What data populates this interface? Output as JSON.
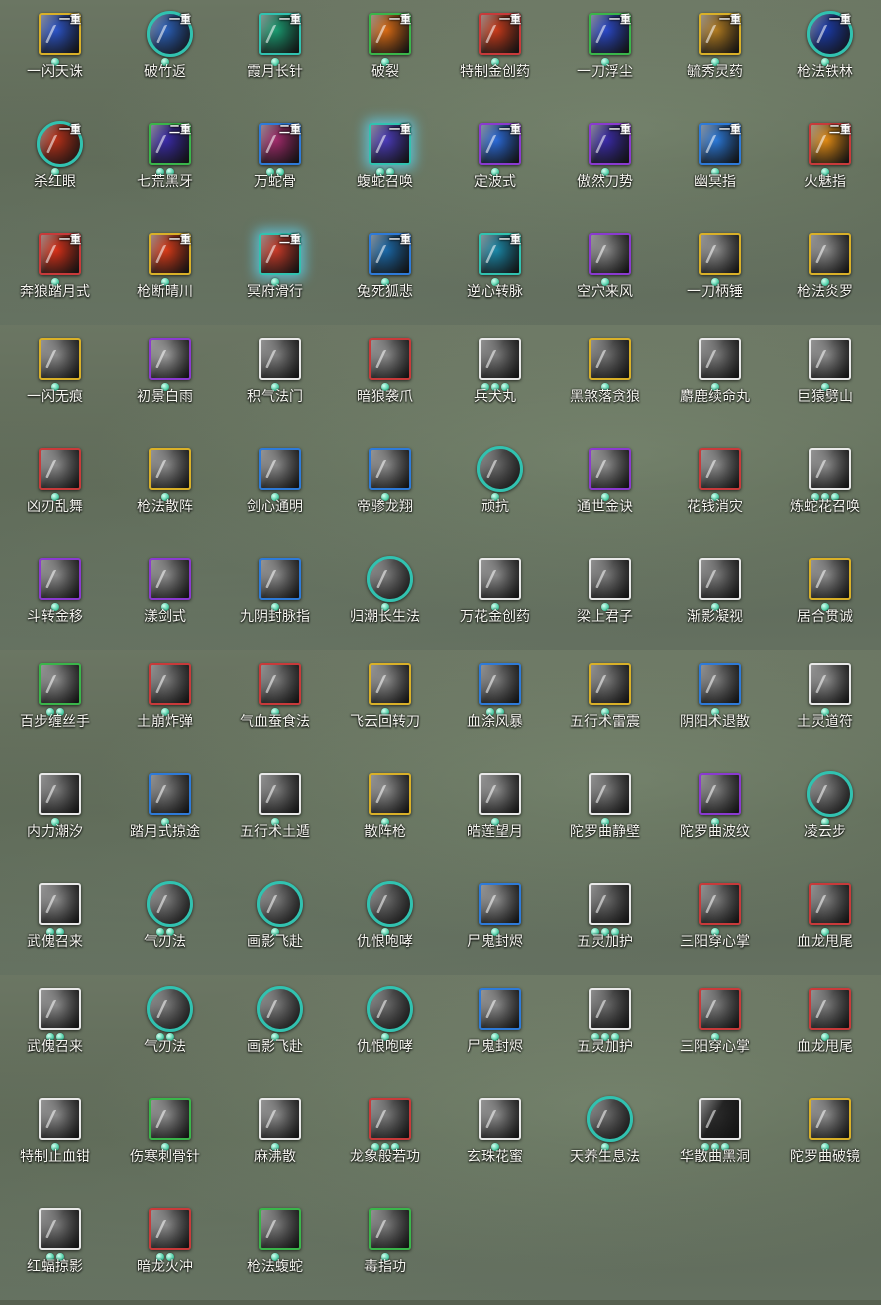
{
  "colors": {
    "white": "#e8e8e8",
    "yellow": "#d9b028",
    "green": "#3ab54a",
    "blue": "#2e7ad8",
    "purple": "#8a3ad0",
    "red": "#c83a3a",
    "teal": "#31c2b0"
  },
  "skills": [
    {
      "name": "一闪天诛",
      "rank": "一重",
      "dots": 1,
      "frame": "yellow",
      "fill": "#2c54c8",
      "shape": "square"
    },
    {
      "name": "破竹返",
      "rank": "一重",
      "dots": 1,
      "frame": "teal",
      "fill": "#2a5fb8",
      "shape": "round"
    },
    {
      "name": "霞月长针",
      "rank": "一重",
      "dots": 1,
      "frame": "teal",
      "fill": "#1a9a70",
      "shape": "square"
    },
    {
      "name": "破裂",
      "rank": "一重",
      "dots": 1,
      "frame": "green",
      "fill": "#d86a14",
      "shape": "square"
    },
    {
      "name": "特制金创药",
      "rank": "一重",
      "dots": 1,
      "frame": "red",
      "fill": "#c83a1a",
      "shape": "square"
    },
    {
      "name": "一刀浮尘",
      "rank": "一重",
      "dots": 1,
      "frame": "green",
      "fill": "#2a48c8",
      "shape": "square"
    },
    {
      "name": "毓秀灵药",
      "rank": "一重",
      "dots": 1,
      "frame": "yellow",
      "fill": "#b07a20",
      "shape": "square"
    },
    {
      "name": "枪法铁林",
      "rank": "一重",
      "dots": 1,
      "frame": "teal",
      "fill": "#1a3aa8",
      "shape": "round"
    },
    {
      "name": "杀红眼",
      "rank": "一重",
      "dots": 1,
      "frame": "teal",
      "fill": "#b83018",
      "shape": "round"
    },
    {
      "name": "七荒黑牙",
      "rank": "二重",
      "dots": 2,
      "frame": "green",
      "fill": "#3a2aa8",
      "shape": "square"
    },
    {
      "name": "万蛇骨",
      "rank": "二重",
      "dots": 2,
      "frame": "blue",
      "fill": "#a02a6a",
      "shape": "square"
    },
    {
      "name": "蝮蛇召唤",
      "rank": "一重",
      "dots": 2,
      "frame": "teal",
      "fill": "#4a3ab8",
      "shape": "square",
      "glow": true
    },
    {
      "name": "定波式",
      "rank": "一重",
      "dots": 1,
      "frame": "purple",
      "fill": "#2a6ad8",
      "shape": "square"
    },
    {
      "name": "傲然刀势",
      "rank": "一重",
      "dots": 1,
      "frame": "purple",
      "fill": "#3a2aa8",
      "shape": "square"
    },
    {
      "name": "幽冥指",
      "rank": "一重",
      "dots": 1,
      "frame": "blue",
      "fill": "#2a78d8",
      "shape": "square"
    },
    {
      "name": "火魅指",
      "rank": "二重",
      "dots": 1,
      "frame": "red",
      "fill": "#e08a14",
      "shape": "square"
    },
    {
      "name": "奔狼踏月式",
      "rank": "一重",
      "dots": 1,
      "frame": "red",
      "fill": "#d83018",
      "shape": "square"
    },
    {
      "name": "枪断晴川",
      "rank": "一重",
      "dots": 1,
      "frame": "yellow",
      "fill": "#d83a18",
      "shape": "square"
    },
    {
      "name": "冥府滑行",
      "rank": "二重",
      "dots": 1,
      "frame": "teal",
      "fill": "#c83a28",
      "shape": "square",
      "glow": true
    },
    {
      "name": "兔死狐悲",
      "rank": "一重",
      "dots": 1,
      "frame": "blue",
      "fill": "#1a68a8",
      "shape": "square"
    },
    {
      "name": "逆心转脉",
      "rank": "一重",
      "dots": 1,
      "frame": "teal",
      "fill": "#1a88a8",
      "shape": "square"
    },
    {
      "name": "空穴来风",
      "rank": "",
      "dots": 1,
      "frame": "purple",
      "fill": "#888888",
      "shape": "square"
    },
    {
      "name": "一刀柄锤",
      "rank": "",
      "dots": 1,
      "frame": "yellow",
      "fill": "#8a8a8a",
      "shape": "square"
    },
    {
      "name": "枪法炎罗",
      "rank": "",
      "dots": 1,
      "frame": "yellow",
      "fill": "#8a8a8a",
      "shape": "square"
    },
    {
      "name": "一闪无痕",
      "rank": "",
      "dots": 1,
      "frame": "yellow",
      "fill": "#8a8a8a",
      "shape": "square"
    },
    {
      "name": "初景白雨",
      "rank": "",
      "dots": 1,
      "frame": "purple",
      "fill": "#9a9a9a",
      "shape": "square"
    },
    {
      "name": "积气法门",
      "rank": "",
      "dots": 1,
      "frame": "white",
      "fill": "#808080",
      "shape": "square"
    },
    {
      "name": "暗狼袭爪",
      "rank": "",
      "dots": 1,
      "frame": "red",
      "fill": "#8a8a8a",
      "shape": "square"
    },
    {
      "name": "兵犬丸",
      "rank": "",
      "dots": 3,
      "frame": "white",
      "fill": "#7a7a7a",
      "shape": "square"
    },
    {
      "name": "黑煞落贪狼",
      "rank": "",
      "dots": 1,
      "frame": "yellow",
      "fill": "#707070",
      "shape": "square"
    },
    {
      "name": "麝鹿续命丸",
      "rank": "",
      "dots": 1,
      "frame": "white",
      "fill": "#7a7a7a",
      "shape": "square"
    },
    {
      "name": "巨猿劈山",
      "rank": "",
      "dots": 1,
      "frame": "white",
      "fill": "#8a8a8a",
      "shape": "square"
    },
    {
      "name": "凶刃乱舞",
      "rank": "",
      "dots": 1,
      "frame": "red",
      "fill": "#8a8a8a",
      "shape": "square"
    },
    {
      "name": "枪法散阵",
      "rank": "",
      "dots": 1,
      "frame": "yellow",
      "fill": "#8a8a8a",
      "shape": "square"
    },
    {
      "name": "剑心通明",
      "rank": "",
      "dots": 1,
      "frame": "blue",
      "fill": "#8a8a8a",
      "shape": "square"
    },
    {
      "name": "帝骖龙翔",
      "rank": "",
      "dots": 1,
      "frame": "blue",
      "fill": "#8a8a8a",
      "shape": "square"
    },
    {
      "name": "顽抗",
      "rank": "",
      "dots": 1,
      "frame": "teal",
      "fill": "#6a6a6a",
      "shape": "round"
    },
    {
      "name": "通世金诀",
      "rank": "",
      "dots": 1,
      "frame": "purple",
      "fill": "#8a8a8a",
      "shape": "square"
    },
    {
      "name": "花钱消灾",
      "rank": "",
      "dots": 1,
      "frame": "red",
      "fill": "#8a8a8a",
      "shape": "square"
    },
    {
      "name": "炼蛇花召唤",
      "rank": "",
      "dots": 3,
      "frame": "white",
      "fill": "#8a8a8a",
      "shape": "square"
    },
    {
      "name": "斗转金移",
      "rank": "",
      "dots": 1,
      "frame": "purple",
      "fill": "#8a8a8a",
      "shape": "square"
    },
    {
      "name": "漾剑式",
      "rank": "",
      "dots": 1,
      "frame": "purple",
      "fill": "#8a8a8a",
      "shape": "square"
    },
    {
      "name": "九阴封脉指",
      "rank": "",
      "dots": 1,
      "frame": "blue",
      "fill": "#8a8a8a",
      "shape": "square"
    },
    {
      "name": "归潮长生法",
      "rank": "",
      "dots": 1,
      "frame": "teal",
      "fill": "#7a7a7a",
      "shape": "round"
    },
    {
      "name": "万花金创药",
      "rank": "",
      "dots": 1,
      "frame": "white",
      "fill": "#8a8a8a",
      "shape": "square"
    },
    {
      "name": "梁上君子",
      "rank": "",
      "dots": 1,
      "frame": "white",
      "fill": "#7a7a7a",
      "shape": "square"
    },
    {
      "name": "渐影凝视",
      "rank": "",
      "dots": 1,
      "frame": "white",
      "fill": "#7a7a7a",
      "shape": "square"
    },
    {
      "name": "居合贯诚",
      "rank": "",
      "dots": 1,
      "frame": "yellow",
      "fill": "#8a8a8a",
      "shape": "square"
    },
    {
      "name": "百步缠丝手",
      "rank": "",
      "dots": 2,
      "frame": "green",
      "fill": "#8a8a8a",
      "shape": "square"
    },
    {
      "name": "土崩炸弹",
      "rank": "",
      "dots": 1,
      "frame": "red",
      "fill": "#7a7a7a",
      "shape": "square"
    },
    {
      "name": "气血蚕食法",
      "rank": "",
      "dots": 1,
      "frame": "red",
      "fill": "#7a7a7a",
      "shape": "square"
    },
    {
      "name": "飞云回转刀",
      "rank": "",
      "dots": 1,
      "frame": "yellow",
      "fill": "#8a8a8a",
      "shape": "square"
    },
    {
      "name": "血涂风暴",
      "rank": "",
      "dots": 2,
      "frame": "blue",
      "fill": "#7a7a7a",
      "shape": "square"
    },
    {
      "name": "五行术雷震",
      "rank": "",
      "dots": 1,
      "frame": "yellow",
      "fill": "#7a7a7a",
      "shape": "square"
    },
    {
      "name": "阴阳术退散",
      "rank": "",
      "dots": 1,
      "frame": "blue",
      "fill": "#7a7a7a",
      "shape": "square"
    },
    {
      "name": "土灵道符",
      "rank": "",
      "dots": 1,
      "frame": "white",
      "fill": "#8a8a8a",
      "shape": "square"
    },
    {
      "name": "内力潮汐",
      "rank": "",
      "dots": 1,
      "frame": "white",
      "fill": "#7a7a7a",
      "shape": "square"
    },
    {
      "name": "踏月式掠途",
      "rank": "",
      "dots": 1,
      "frame": "blue",
      "fill": "#7a7a7a",
      "shape": "square"
    },
    {
      "name": "五行术土遁",
      "rank": "",
      "dots": 1,
      "frame": "white",
      "fill": "#7a7a7a",
      "shape": "square"
    },
    {
      "name": "散阵枪",
      "rank": "",
      "dots": 1,
      "frame": "yellow",
      "fill": "#8a8a8a",
      "shape": "square"
    },
    {
      "name": "皓莲望月",
      "rank": "",
      "dots": 1,
      "frame": "white",
      "fill": "#8a8a8a",
      "shape": "square"
    },
    {
      "name": "陀罗曲静壁",
      "rank": "",
      "dots": 1,
      "frame": "white",
      "fill": "#7a7a7a",
      "shape": "square"
    },
    {
      "name": "陀罗曲波纹",
      "rank": "",
      "dots": 1,
      "frame": "purple",
      "fill": "#7a7a7a",
      "shape": "square"
    },
    {
      "name": "凌云步",
      "rank": "",
      "dots": 1,
      "frame": "teal",
      "fill": "#7a7a7a",
      "shape": "round"
    },
    {
      "name": "武傀召来",
      "rank": "",
      "dots": 2,
      "frame": "white",
      "fill": "#8a8a8a",
      "shape": "square"
    },
    {
      "name": "气刃法",
      "rank": "",
      "dots": 2,
      "frame": "teal",
      "fill": "#7a7a7a",
      "shape": "round"
    },
    {
      "name": "画影飞赴",
      "rank": "",
      "dots": 1,
      "frame": "teal",
      "fill": "#7a7a7a",
      "shape": "round"
    },
    {
      "name": "仇恨咆哮",
      "rank": "",
      "dots": 1,
      "frame": "teal",
      "fill": "#6a6a6a",
      "shape": "round"
    },
    {
      "name": "尸鬼封烬",
      "rank": "",
      "dots": 1,
      "frame": "blue",
      "fill": "#8a8a8a",
      "shape": "square"
    },
    {
      "name": "五灵加护",
      "rank": "",
      "dots": 3,
      "frame": "white",
      "fill": "#6a6a6a",
      "shape": "square"
    },
    {
      "name": "三阳穿心掌",
      "rank": "",
      "dots": 1,
      "frame": "red",
      "fill": "#7a7a7a",
      "shape": "square"
    },
    {
      "name": "血龙甩尾",
      "rank": "",
      "dots": 1,
      "frame": "red",
      "fill": "#7a7a7a",
      "shape": "square"
    },
    {
      "name": "武傀召来",
      "rank": "",
      "dots": 2,
      "frame": "white",
      "fill": "#8a8a8a",
      "shape": "square"
    },
    {
      "name": "气刃法",
      "rank": "",
      "dots": 2,
      "frame": "teal",
      "fill": "#7a7a7a",
      "shape": "round"
    },
    {
      "name": "画影飞赴",
      "rank": "",
      "dots": 1,
      "frame": "teal",
      "fill": "#7a7a7a",
      "shape": "round"
    },
    {
      "name": "仇恨咆哮",
      "rank": "",
      "dots": 1,
      "frame": "teal",
      "fill": "#6a6a6a",
      "shape": "round"
    },
    {
      "name": "尸鬼封烬",
      "rank": "",
      "dots": 1,
      "frame": "blue",
      "fill": "#8a8a8a",
      "shape": "square"
    },
    {
      "name": "五灵加护",
      "rank": "",
      "dots": 3,
      "frame": "white",
      "fill": "#6a6a6a",
      "shape": "square"
    },
    {
      "name": "三阳穿心掌",
      "rank": "",
      "dots": 1,
      "frame": "red",
      "fill": "#7a7a7a",
      "shape": "square"
    },
    {
      "name": "血龙甩尾",
      "rank": "",
      "dots": 1,
      "frame": "red",
      "fill": "#7a7a7a",
      "shape": "square"
    },
    {
      "name": "特制止血钳",
      "rank": "",
      "dots": 1,
      "frame": "white",
      "fill": "#8a8a8a",
      "shape": "square"
    },
    {
      "name": "伤寒刺骨针",
      "rank": "",
      "dots": 1,
      "frame": "green",
      "fill": "#8a8a8a",
      "shape": "square"
    },
    {
      "name": "麻沸散",
      "rank": "",
      "dots": 1,
      "frame": "white",
      "fill": "#8a8a8a",
      "shape": "square"
    },
    {
      "name": "龙象般若功",
      "rank": "",
      "dots": 3,
      "frame": "red",
      "fill": "#7a7a7a",
      "shape": "square"
    },
    {
      "name": "玄珠花蜜",
      "rank": "",
      "dots": 1,
      "frame": "white",
      "fill": "#8a8a8a",
      "shape": "square"
    },
    {
      "name": "天养生息法",
      "rank": "",
      "dots": 1,
      "frame": "teal",
      "fill": "#6a6a6a",
      "shape": "round"
    },
    {
      "name": "华散曲黑洞",
      "rank": "",
      "dots": 3,
      "frame": "white",
      "fill": "#2a2a2a",
      "shape": "square"
    },
    {
      "name": "陀罗曲破镜",
      "rank": "",
      "dots": 1,
      "frame": "yellow",
      "fill": "#8a8a8a",
      "shape": "square"
    },
    {
      "name": "红蝠掠影",
      "rank": "",
      "dots": 2,
      "frame": "white",
      "fill": "#7a7a7a",
      "shape": "square"
    },
    {
      "name": "暗龙火冲",
      "rank": "",
      "dots": 2,
      "frame": "red",
      "fill": "#8a8a8a",
      "shape": "square"
    },
    {
      "name": "枪法蝮蛇",
      "rank": "",
      "dots": 1,
      "frame": "green",
      "fill": "#7a7a7a",
      "shape": "square"
    },
    {
      "name": "毒指功",
      "rank": "",
      "dots": 1,
      "frame": "green",
      "fill": "#7a7a7a",
      "shape": "square"
    }
  ]
}
